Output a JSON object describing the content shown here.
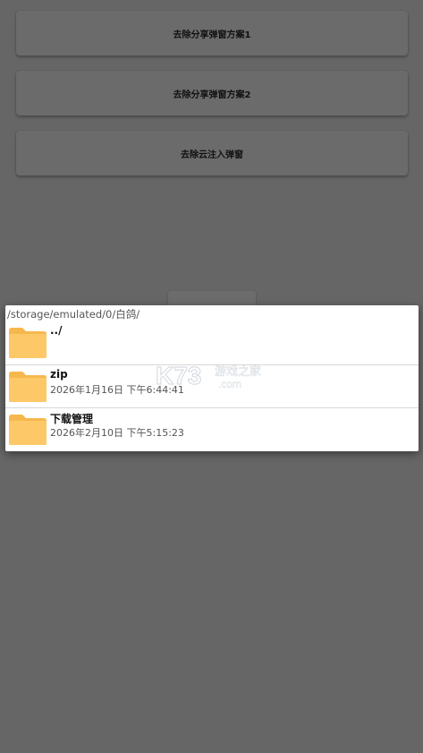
{
  "buttons": [
    {
      "label": "去除分享弹窗方案1"
    },
    {
      "label": "去除分享弹窗方案2"
    },
    {
      "label": "去除云注入弹窗"
    }
  ],
  "dialog": {
    "path": "/storage/emulated/0/白鸽/",
    "entries": [
      {
        "name": "../",
        "date": "",
        "icon": "folder-icon"
      },
      {
        "name": "zip",
        "date": "2026年1月16日 下午6:44:41",
        "icon": "folder-icon"
      },
      {
        "name": "下载管理",
        "date": "2026年2月10日 下午5:15:23",
        "icon": "folder-icon"
      }
    ]
  },
  "watermark": {
    "brand": "K73",
    "text": "游戏之家",
    "domain": ".com"
  },
  "colors": {
    "background": "#666666",
    "folder": "#fdc868",
    "folder_tab": "#f6b84d",
    "dialog": "#ffffff"
  }
}
